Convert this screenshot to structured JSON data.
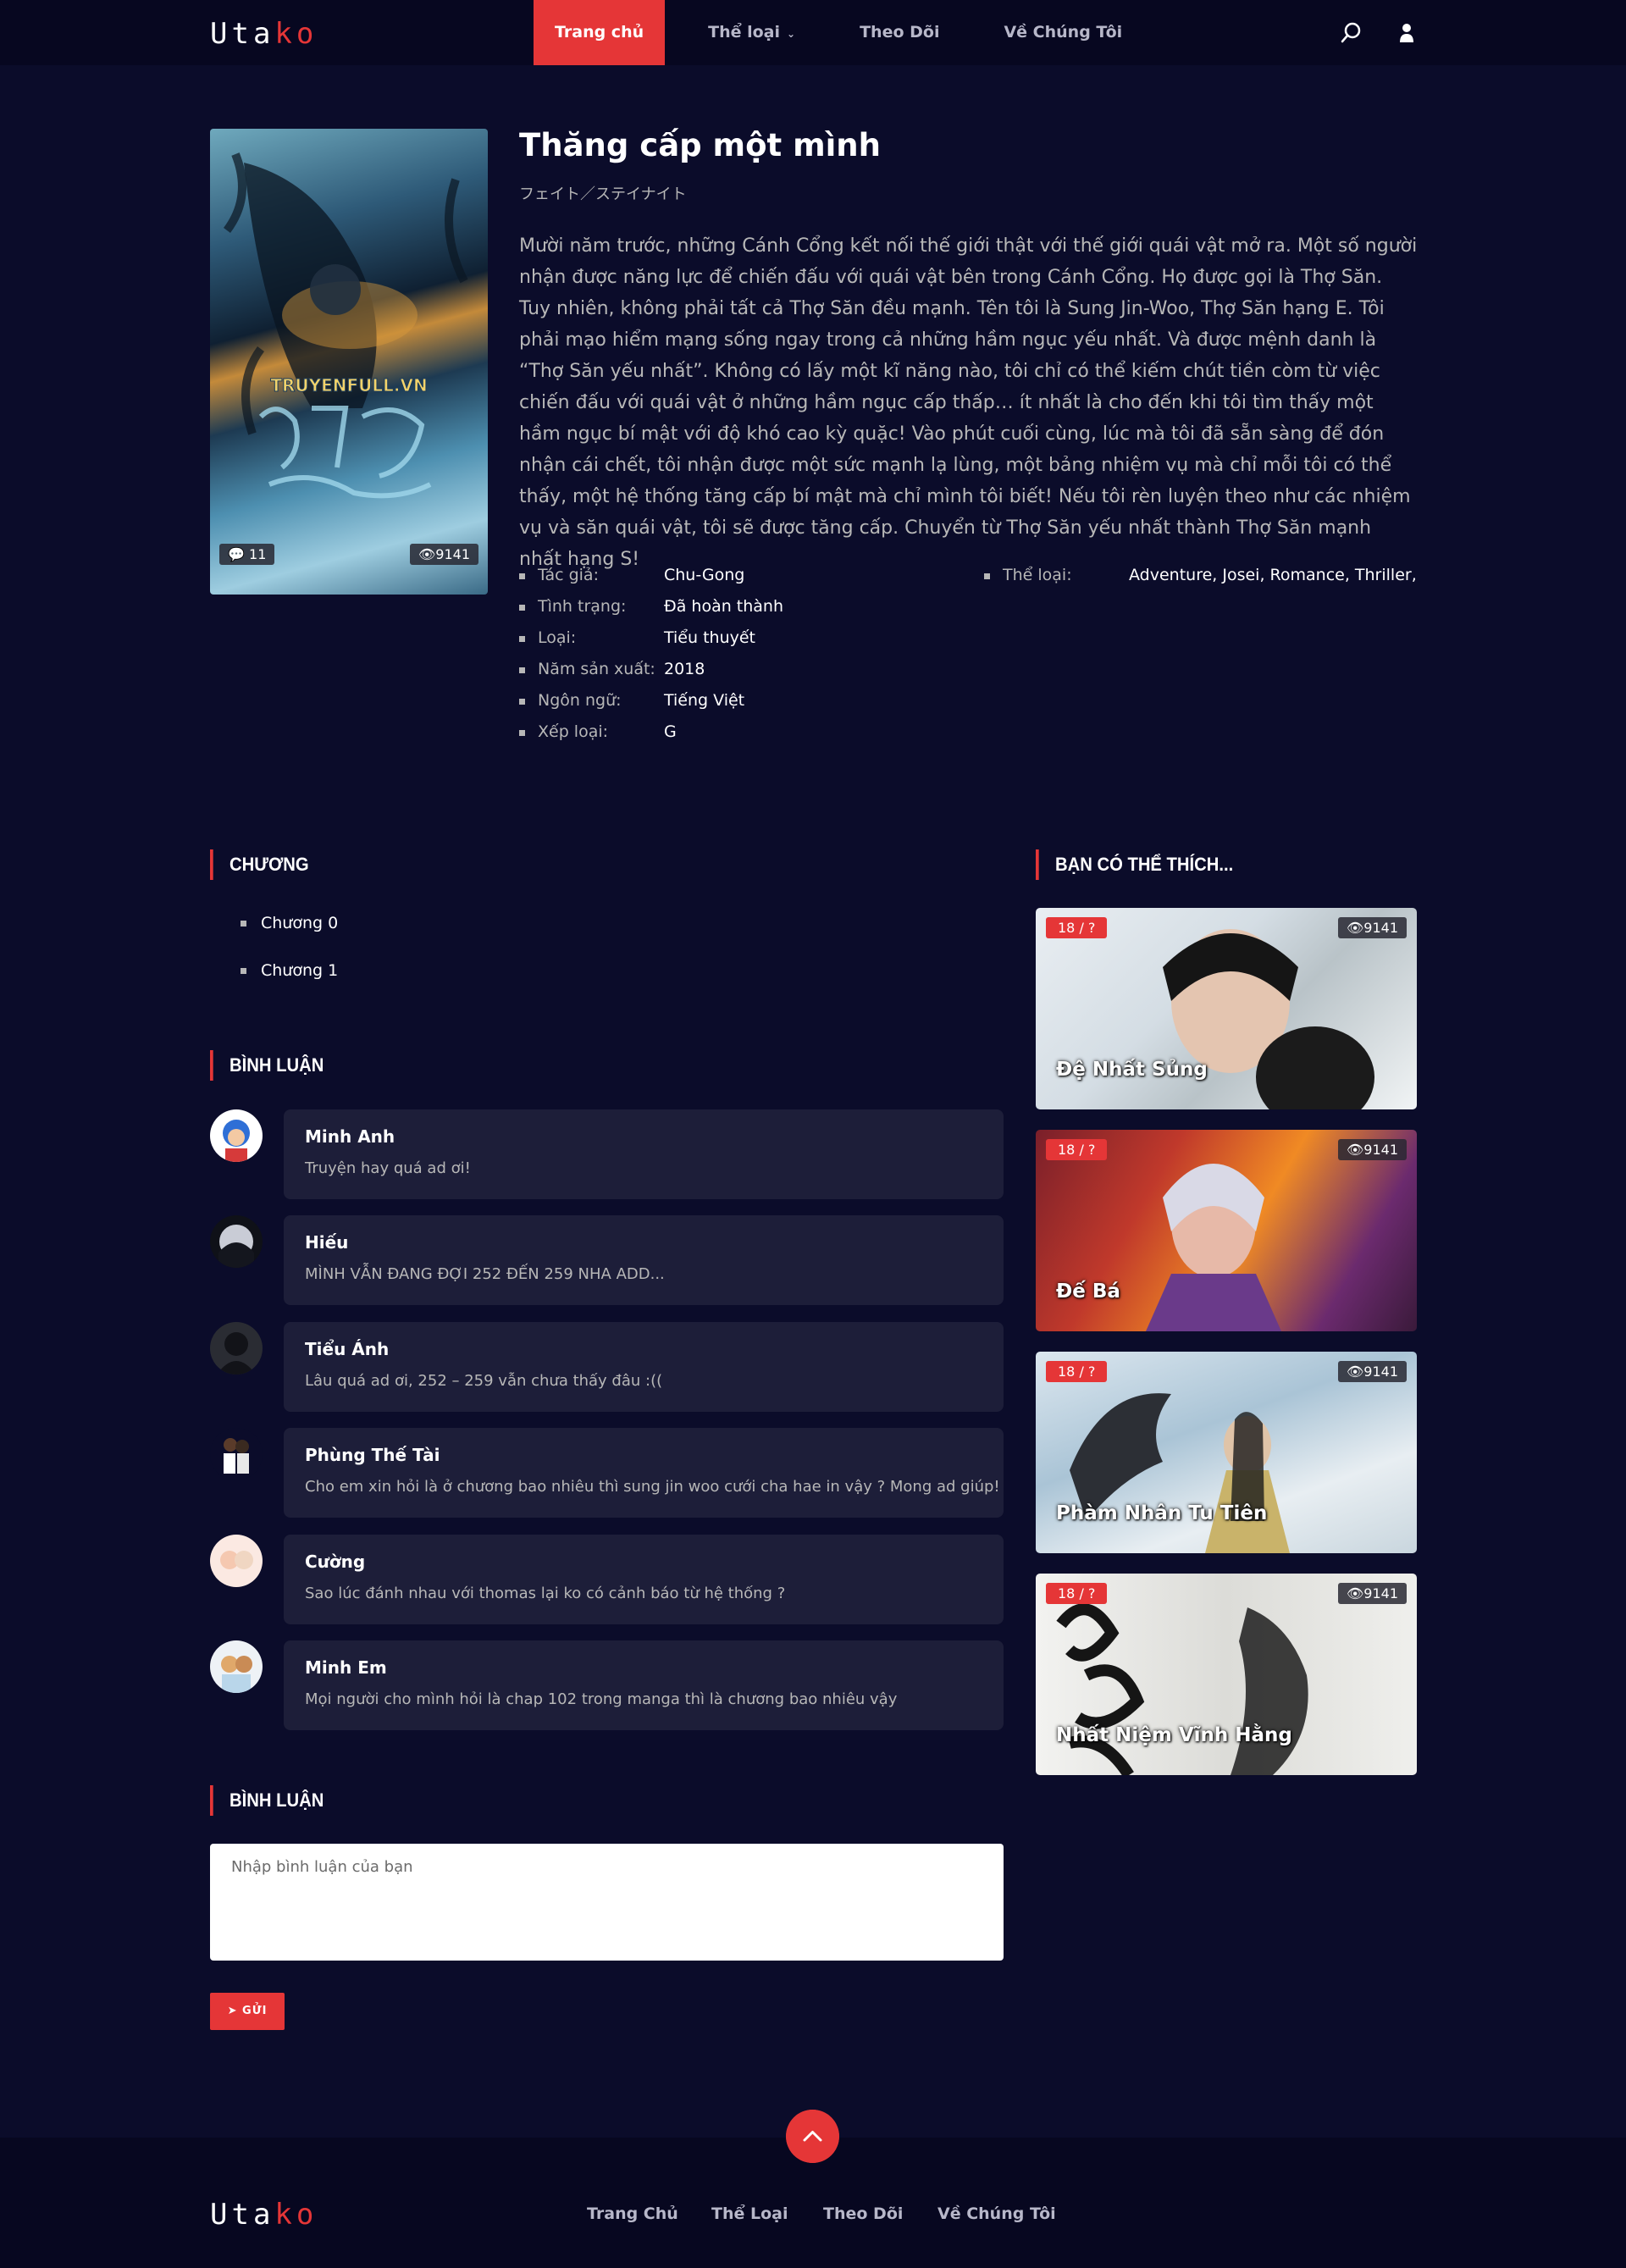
{
  "header": {
    "logo_main": "Uta",
    "logo_accent": "ko",
    "nav": [
      {
        "label": "Trang chủ"
      },
      {
        "label": "Thể loại"
      },
      {
        "label": "Theo Dõi"
      },
      {
        "label": "Về Chúng Tôi"
      }
    ]
  },
  "story": {
    "title": "Thăng cấp một mình",
    "subtitle": "フェイト／ステイナイト",
    "description": "Mười năm trước, những Cánh Cổng kết nối thế giới thật với thế giới quái vật mở ra. Một số người nhận được năng lực để chiến đấu với quái vật bên trong Cánh Cổng. Họ được gọi là Thợ Săn. Tuy nhiên, không phải tất cả Thợ Săn đều mạnh. Tên tôi là Sung Jin-Woo, Thợ Săn hạng E. Tôi phải mạo hiểm mạng sống ngay trong cả những hầm ngục yếu nhất. Và được mệnh danh là “Thợ Săn yếu nhất”. Không có lấy một kĩ năng nào, tôi chỉ có thể kiếm chút tiền còm từ việc chiến đấu với quái vật ở những hầm ngục cấp thấp… ít nhất là cho đến khi tôi tìm thấy một hầm ngục bí mật với độ khó cao kỳ quặc! Vào phút cuối cùng, lúc mà tôi đã sẵn sàng để đón nhận cái chết, tôi nhận được một sức mạnh lạ lùng, một bảng nhiệm vụ mà chỉ mỗi tôi có thể thấy, một hệ thống tăng cấp bí mật mà chỉ mình tôi biết! Nếu tôi rèn luyện theo như các nhiệm vụ và săn quái vật, tôi sẽ được tăng cấp. Chuyển từ Thợ Săn yếu nhất thành Thợ Săn mạnh nhất hạng S!",
    "comments_count": "11",
    "views": "9141",
    "cover_text": "TRUYENFULL.VN",
    "info_left": [
      {
        "key": "Tác giả:",
        "value": "Chu-Gong"
      },
      {
        "key": "Tình trạng:",
        "value": "Đã hoàn thành"
      },
      {
        "key": "Loại:",
        "value": "Tiểu thuyết"
      },
      {
        "key": "Năm sản xuất:",
        "value": "2018"
      },
      {
        "key": "Ngôn ngữ:",
        "value": "Tiếng Việt"
      },
      {
        "key": "Xếp loại:",
        "value": "G"
      }
    ],
    "info_right": [
      {
        "key": "Thể loại:",
        "value": "Adventure, Josei, Romance, Thriller,"
      }
    ]
  },
  "chapters": {
    "title": "CHƯƠNG",
    "items": [
      "Chương 0",
      "Chương 1"
    ]
  },
  "comments": {
    "title": "BÌNH LUẬN",
    "items": [
      {
        "name": "Minh Anh",
        "text": "Truyện hay quá ad ơi!"
      },
      {
        "name": "Hiếu",
        "text": "MÌNH VẪN ĐANG ĐỢI 252 ĐẾN 259 NHA ADD..."
      },
      {
        "name": "Tiểu Ánh",
        "text": "Lâu quá ad ơi, 252 – 259 vẫn chưa thấy đâu :(("
      },
      {
        "name": "Phùng Thế Tài",
        "text": "Cho em xin hỏi là ở chương bao nhiêu thì sung jin woo cưới cha hae in vậy ? Mong ad giúp!"
      },
      {
        "name": "Cường",
        "text": "Sao lúc đánh nhau với thomas lại ko có cảnh báo từ hệ thống ?"
      },
      {
        "name": "Minh Em",
        "text": "Mọi người cho mình hỏi là chap 102 trong manga thì là chương bao nhiêu vậy"
      }
    ]
  },
  "comment_form": {
    "title": "BÌNH LUẬN",
    "placeholder": "Nhập bình luận của bạn",
    "send_label": "GỬI"
  },
  "recommend": {
    "title": "BẠN CÓ THỂ THÍCH...",
    "items": [
      {
        "episodes": "18 / ?",
        "views": "9141",
        "title": "Đệ Nhất Sủng"
      },
      {
        "episodes": "18 / ?",
        "views": "9141",
        "title": "Đế Bá"
      },
      {
        "episodes": "18 / ?",
        "views": "9141",
        "title": "Phàm Nhân Tu Tiên"
      },
      {
        "episodes": "18 / ?",
        "views": "9141",
        "title": "Nhất Niệm Vĩnh Hằng"
      }
    ]
  },
  "footer": {
    "logo_main": "Uta",
    "logo_accent": "ko",
    "nav": [
      "Trang Chủ",
      "Thể Loại",
      "Theo Dõi",
      "Về Chúng Tôi"
    ]
  },
  "colors": {
    "background": "#0b0c2a",
    "header": "#070720",
    "accent": "#e53637",
    "card": "#1d1e39",
    "muted_text": "#b7b7b7"
  }
}
